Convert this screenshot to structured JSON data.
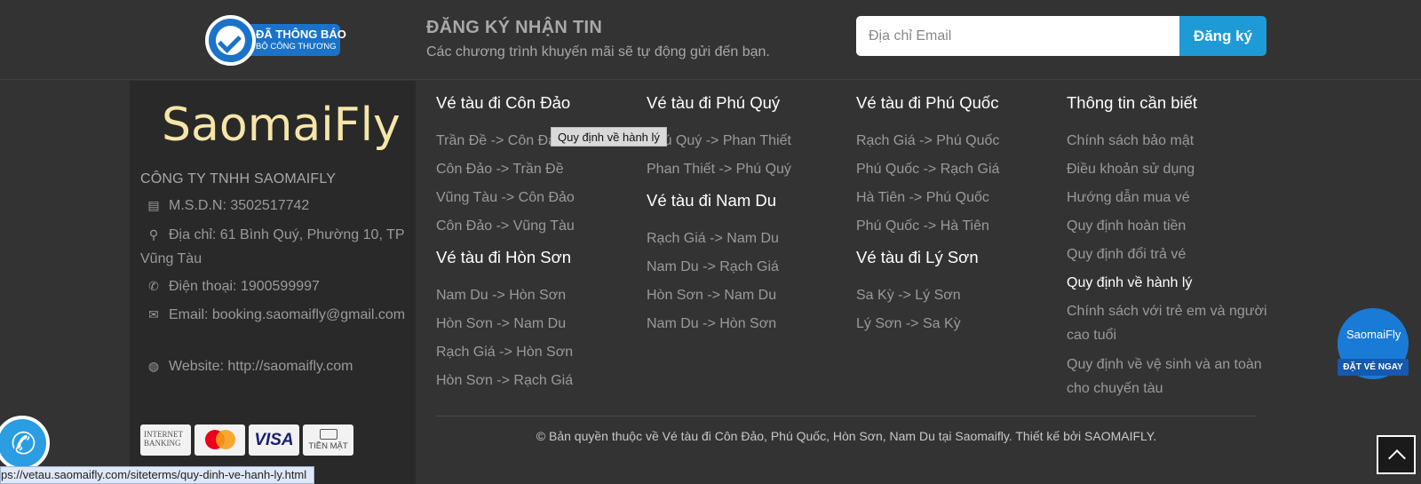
{
  "badge": {
    "line1": "ĐÃ THÔNG BÁO",
    "line2": "BỘ CÔNG THƯƠNG"
  },
  "newsletter": {
    "title": "ĐĂNG KÝ NHẬN TIN",
    "subtitle": "Các chương trình khuyến mãi sẽ tự động gửi đến bạn.",
    "placeholder": "Địa chỉ Email",
    "button": "Đăng ký"
  },
  "company": {
    "logo_text": "SaomaiFly",
    "name": "CÔNG TY TNHH SAOMAIFLY",
    "tax": "M.S.D.N: 3502517742",
    "address": "Địa chỉ: 61 Bình Quý, Phường 10, TP Vũng Tàu",
    "phone": "Điện thoại: 1900599997",
    "email": "Email: booking.saomaifly@gmail.com",
    "website": "Website: http://saomaifly.com"
  },
  "payments": {
    "internet_banking": "INTERNET BANKING",
    "visa": "VISA",
    "cash": "TIỀN MẶT"
  },
  "columns": {
    "con_dao": {
      "title": "Vé tàu đi Côn Đảo",
      "links": [
        "Trần Đề -> Côn Đảo",
        "Côn Đảo -> Trần Đề",
        "Vũng Tàu -> Côn Đảo",
        "Côn Đảo -> Vũng Tàu"
      ]
    },
    "hon_son": {
      "title": "Vé tàu đi Hòn Sơn",
      "links": [
        "Nam Du -> Hòn Sơn",
        "Hòn Sơn -> Nam Du",
        "Rạch Giá -> Hòn Sơn",
        "Hòn Sơn -> Rạch Giá"
      ]
    },
    "phu_quy": {
      "title": "Vé tàu đi Phú Quý",
      "links": [
        "Phú Quý -> Phan Thiết",
        "Phan Thiết -> Phú Quý"
      ]
    },
    "nam_du": {
      "title": "Vé tàu đi Nam Du",
      "links": [
        "Rạch Giá -> Nam Du",
        "Nam Du -> Rạch Giá",
        "Hòn Sơn -> Nam Du",
        "Nam Du -> Hòn Sơn"
      ]
    },
    "phu_quoc": {
      "title": "Vé tàu đi Phú Quốc",
      "links": [
        "Rạch Giá -> Phú Quốc",
        "Phú Quốc -> Rạch Giá",
        "Hà Tiên -> Phú Quốc",
        "Phú Quốc -> Hà Tiên"
      ]
    },
    "ly_son": {
      "title": "Vé tàu đi Lý Sơn",
      "links": [
        "Sa Kỳ -> Lý Sơn",
        "Lý Sơn -> Sa Kỳ"
      ]
    },
    "info": {
      "title": "Thông tin cần biết",
      "links": [
        "Chính sách bảo mật",
        "Điều khoản sử dụng",
        "Hướng dẫn mua vé",
        "Quy định hoàn tiền",
        "Quy định đổi trả vé",
        "Quy định về hành lý",
        "Chính sách với trẻ em và người cao tuổi",
        "Quy định về vệ sinh và an toàn cho chuyến tàu"
      ]
    }
  },
  "copyright": "© Bản quyền thuộc về Vé tàu đi Côn Đảo, Phú Quốc, Hòn Sơn, Nam Du tại Saomaifly.  Thiết kế bởi SAOMAIFLY.",
  "tooltip": "Quy định về hành lý",
  "float_badge": {
    "logo": "SaomaiFly",
    "button": "ĐẶT VÉ NGAY"
  },
  "status_url": "ps://vetau.saomaifly.com/siteterms/quy-dinh-ve-hanh-ly.html",
  "colors": {
    "accent": "#1e9bd7",
    "background": "#333333",
    "panel": "#292929"
  }
}
